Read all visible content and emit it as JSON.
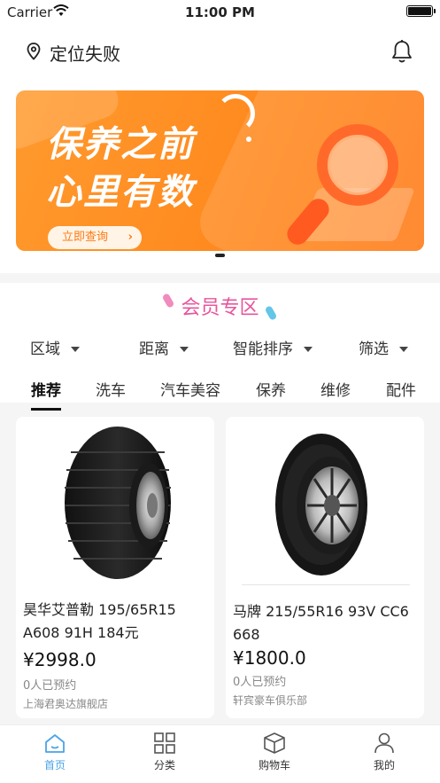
{
  "status": {
    "carrier": "Carrier",
    "time": "11:00 PM"
  },
  "header": {
    "location_text": "定位失败",
    "location_icon": "location-pin-icon",
    "notification_icon": "bell-icon"
  },
  "banner": {
    "line1": "保养之前",
    "line2": "心里有数",
    "cta_label": "立即查询",
    "accent_color": "#ff8a1f"
  },
  "member": {
    "title": "会员专区"
  },
  "filters": [
    {
      "label": "区域"
    },
    {
      "label": "距离"
    },
    {
      "label": "智能排序"
    },
    {
      "label": "筛选"
    }
  ],
  "tabs": [
    {
      "label": "推荐",
      "active": true
    },
    {
      "label": "洗车"
    },
    {
      "label": "汽车美容"
    },
    {
      "label": "保养"
    },
    {
      "label": "维修"
    },
    {
      "label": "配件"
    }
  ],
  "products": [
    {
      "name": "昊华艾普勒 195/65R15 A608 91H 184元",
      "price": "¥2998.0",
      "booked": "0人已预约",
      "shop": "上海君奥达旗舰店"
    },
    {
      "name": "马牌 215/55R16 93V CC6 668",
      "price": "¥1800.0",
      "booked": "0人已预约",
      "shop": "轩宾豪车俱乐部"
    }
  ],
  "tabbar": [
    {
      "label": "首页",
      "icon": "home-icon",
      "active": true
    },
    {
      "label": "分类",
      "icon": "category-grid-icon"
    },
    {
      "label": "购物车",
      "icon": "cart-box-icon"
    },
    {
      "label": "我的",
      "icon": "user-icon"
    }
  ]
}
